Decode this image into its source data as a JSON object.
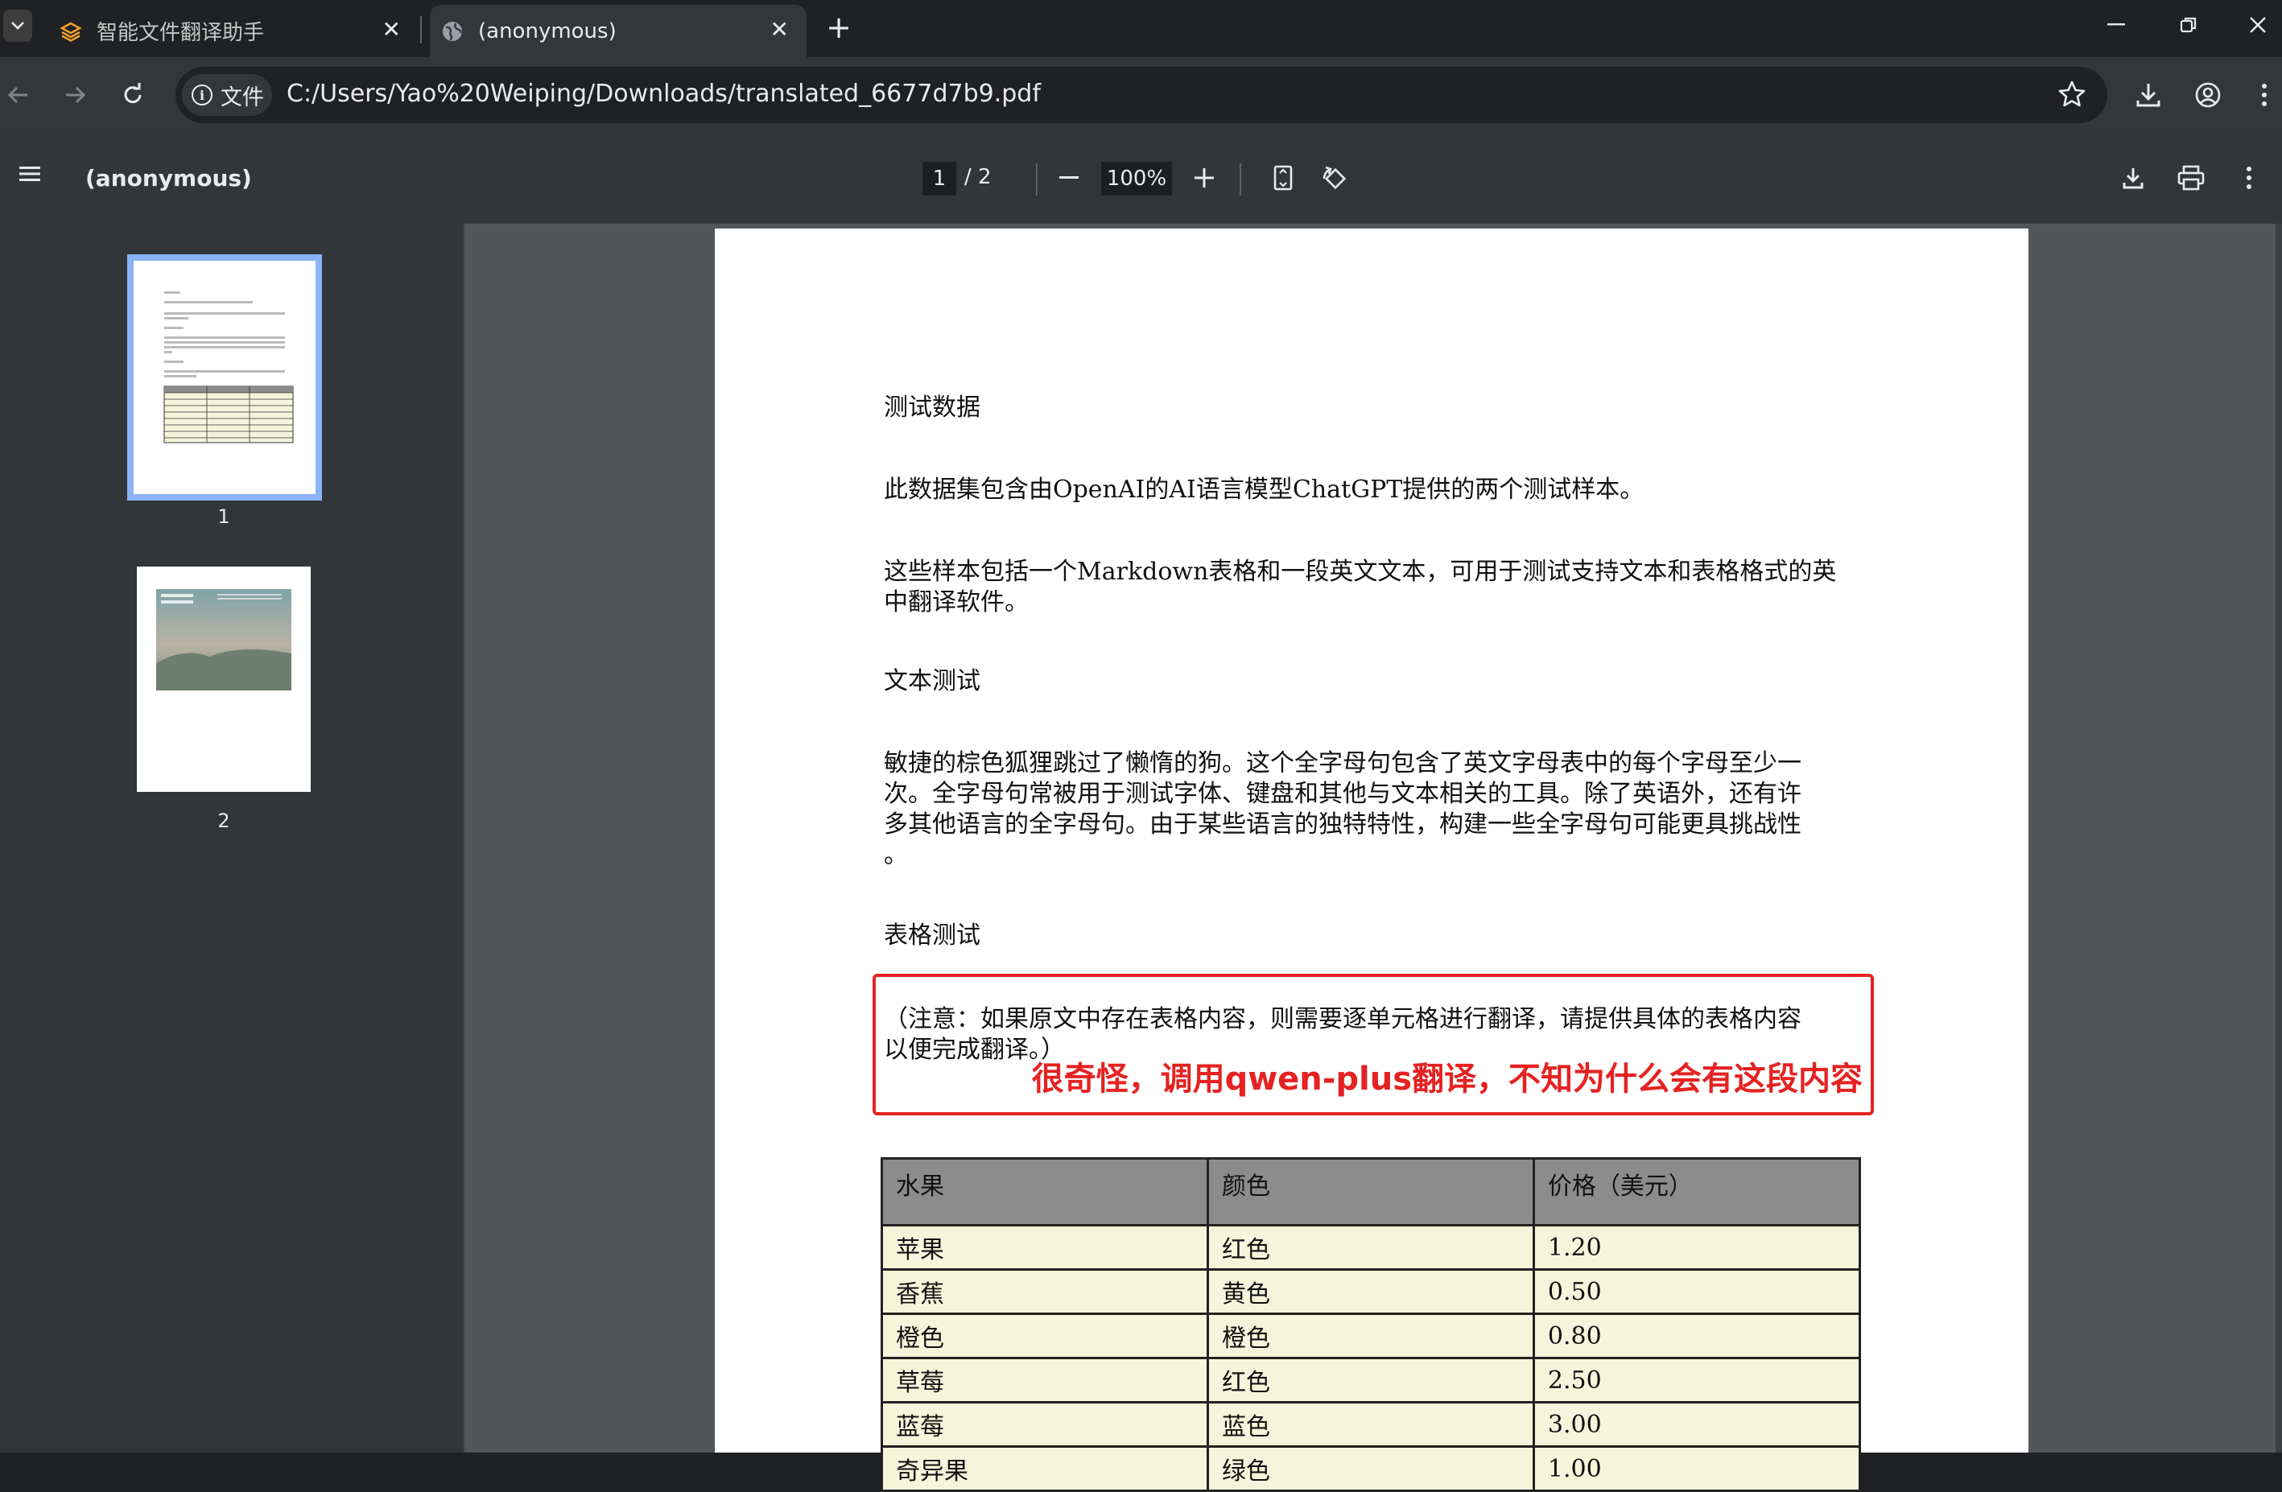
{
  "tabs": [
    {
      "title": "智能文件翻译助手",
      "active": false
    },
    {
      "title": "(anonymous)",
      "active": true
    }
  ],
  "address": {
    "chip_label": "文件",
    "url": "C:/Users/Yao%20Weiping/Downloads/translated_6677d7b9.pdf"
  },
  "pdf_toolbar": {
    "title": "(anonymous)",
    "current_page": "1",
    "page_count": "/  2",
    "zoom": "100%"
  },
  "thumbnails": [
    {
      "label": "1"
    },
    {
      "label": "2"
    }
  ],
  "document": {
    "heading1": "测试数据",
    "para1": "此数据集包含由OpenAI的AI语言模型ChatGPT提供的两个测试样本。",
    "para2_line1": "这些样本包括一个Markdown表格和一段英文文本，可用于测试支持文本和表格格式的英",
    "para2_line2": "中翻译软件。",
    "heading2": "文本测试",
    "para3_line1": "敏捷的棕色狐狸跳过了懒惰的狗。这个全字母句包含了英文字母表中的每个字母至少一",
    "para3_line2": "次。全字母句常被用于测试字体、键盘和其他与文本相关的工具。除了英语外，还有许",
    "para3_line3": "多其他语言的全字母句。由于某些语言的独特特性，构建一些全字母句可能更具挑战性",
    "para3_line4": "。",
    "heading3": "表格测试",
    "note_line1": "（注意：如果原文中存在表格内容，则需要逐单元格进行翻译，请提供具体的表格内容",
    "note_line2": "以便完成翻译。）",
    "annotation": "很奇怪，调用qwen-plus翻译，不知为什么会有这段内容",
    "table": {
      "headers": [
        "水果",
        "颜色",
        "价格（美元）"
      ],
      "rows": [
        [
          "苹果",
          "红色",
          "1.20"
        ],
        [
          "香蕉",
          "黄色",
          "0.50"
        ],
        [
          "橙色",
          "橙色",
          "0.80"
        ],
        [
          "草莓",
          "红色",
          "2.50"
        ],
        [
          "蓝莓",
          "蓝色",
          "3.00"
        ],
        [
          "奇异果",
          "绿色",
          "1.00"
        ]
      ]
    }
  },
  "colors": {
    "accent_annotation": "#e52222",
    "table_header": "#8c8c8c",
    "table_cell": "#f5f5dc",
    "thumb_selected": "#8ab4f8"
  }
}
